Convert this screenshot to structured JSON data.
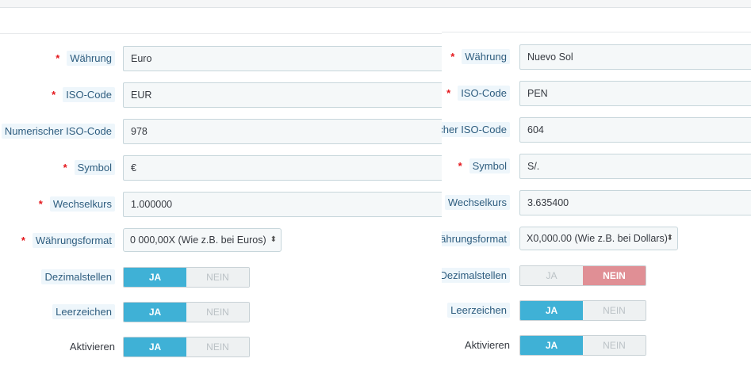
{
  "left": {
    "fields": [
      {
        "label": "Währung",
        "required": true,
        "value": "Euro"
      },
      {
        "label": "ISO-Code",
        "required": true,
        "value": "EUR"
      },
      {
        "label": "Numerischer ISO-Code",
        "required": false,
        "value": "978"
      },
      {
        "label": "Symbol",
        "required": true,
        "value": "€"
      },
      {
        "label": "Wechselkurs",
        "required": true,
        "value": "1.000000"
      }
    ],
    "format": {
      "label": "Währungsformat",
      "required": true,
      "value": "0 000,00X (Wie z.B. bei Euros)"
    },
    "toggles": [
      {
        "label": "Dezimalstellen",
        "yes": "JA",
        "no": "NEIN",
        "selected": "JA"
      },
      {
        "label": "Leerzeichen",
        "yes": "JA",
        "no": "NEIN",
        "selected": "JA"
      },
      {
        "label": "Aktivieren",
        "yes": "JA",
        "no": "NEIN",
        "selected": "JA"
      }
    ]
  },
  "right": {
    "fields": [
      {
        "label": "Währung",
        "required": true,
        "value": "Nuevo Sol"
      },
      {
        "label": "ISO-Code",
        "required": true,
        "value": "PEN"
      },
      {
        "label": "cher ISO-Code",
        "required": false,
        "value": "604"
      },
      {
        "label": "Symbol",
        "required": true,
        "value": "S/."
      },
      {
        "label": "Wechselkurs",
        "required": false,
        "value": "3.635400"
      }
    ],
    "format": {
      "label": "ährungsformat",
      "required": false,
      "value": "X0,000.00 (Wie z.B. bei Dollars)"
    },
    "toggles": [
      {
        "label": "Dezimalstellen",
        "yes": "JA",
        "no": "NEIN",
        "selected": "NEIN"
      },
      {
        "label": "Leerzeichen",
        "yes": "JA",
        "no": "NEIN",
        "selected": "JA"
      },
      {
        "label": "Aktivieren",
        "yes": "JA",
        "no": "NEIN",
        "selected": "JA"
      }
    ]
  },
  "icons": {
    "select_arrow": "⬍",
    "required_marker": "*"
  },
  "colors": {
    "toggle_yes_active": "#3fb1d6",
    "toggle_no_active": "#e08f95",
    "required": "#e4161b",
    "label_highlight": "#eef6fb"
  }
}
